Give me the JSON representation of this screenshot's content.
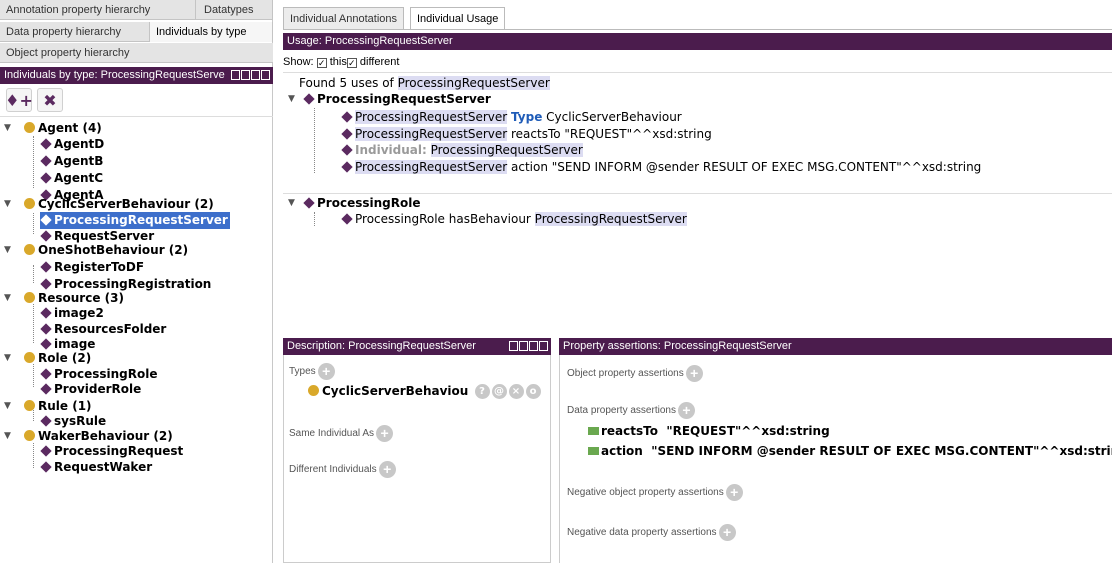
{
  "left_tabs": {
    "annotation_property_hierarchy": "Annotation property hierarchy",
    "datatypes": "Datatypes",
    "data_property_hierarchy": "Data property hierarchy",
    "individuals_by_type": "Individuals by type",
    "object_property_hierarchy": "Object property hierarchy"
  },
  "individuals_panel": {
    "title": "Individuals by type: ProcessingRequestServe",
    "add_icon": "add-individual-icon",
    "delete_icon": "delete-individual-icon"
  },
  "tree": {
    "agent": "Agent (4)",
    "agentD": "AgentD",
    "agentB": "AgentB",
    "agentC": "AgentC",
    "agentA": "AgentA",
    "cyclic": "CyclicServerBehaviour (2)",
    "prs": "ProcessingRequestServer",
    "requestServer": "RequestServer",
    "oneshot": "OneShotBehaviour (2)",
    "registerToDF": "RegisterToDF",
    "processingRegistration": "ProcessingRegistration",
    "resource": "Resource (3)",
    "image2": "image2",
    "resourcesFolder": "ResourcesFolder",
    "image": "image",
    "role": "Role (2)",
    "processingRole": "ProcessingRole",
    "providerRole": "ProviderRole",
    "rule": "Rule (1)",
    "sysRule": "sysRule",
    "waker": "WakerBehaviour (2)",
    "processingRequest": "ProcessingRequest",
    "requestWaker": "RequestWaker"
  },
  "top_tabs": {
    "annotations": "Individual Annotations",
    "usage": "Individual Usage"
  },
  "usage": {
    "header": "Usage: ProcessingRequestServer",
    "show_label": "Show:",
    "this_label": "this",
    "different_label": "different",
    "found_prefix": "Found 5 uses of ",
    "found_entity": "ProcessingRequestServer",
    "group1": "ProcessingRequestServer",
    "l1_subject": "ProcessingRequestServer",
    "l1_kw": "Type",
    "l1_object": "CyclicServerBehaviour",
    "l2_subject": "ProcessingRequestServer",
    "l2_rest": " reactsTo \"REQUEST\"^^xsd:string",
    "l3_kw": "Individual:",
    "l3_entity": "ProcessingRequestServer",
    "l4_subject": "ProcessingRequestServer",
    "l4_rest": " action \"SEND INFORM @sender RESULT OF EXEC MSG.CONTENT\"^^xsd:string",
    "group2": "ProcessingRole",
    "l5_prefix": "ProcessingRole hasBehaviour ",
    "l5_entity": "ProcessingRequestServer"
  },
  "description": {
    "header": "Description: ProcessingRequestServer",
    "types_label": "Types",
    "type_value": "CyclicServerBehaviou",
    "same_label": "Same Individual As",
    "different_label": "Different Individuals"
  },
  "assertions": {
    "header": "Property assertions: ProcessingRequestServer",
    "object_label": "Object property assertions",
    "data_label": "Data property assertions",
    "row1_prop": "reactsTo",
    "row1_value": "\"REQUEST\"^^xsd:string",
    "row2_prop": "action",
    "row2_value": "\"SEND INFORM @sender RESULT OF EXEC MSG.CONTENT\"^^xsd:string",
    "neg_object_label": "Negative object property assertions",
    "neg_data_label": "Negative data property assertions"
  },
  "colors": {
    "panel_header": "#4b1c4d",
    "selection": "#3d6fcb",
    "individual": "#5b2a60",
    "class_dot": "#d9a82a",
    "highlight": "#dcdcf2",
    "keyword": "#1f5cb8"
  }
}
